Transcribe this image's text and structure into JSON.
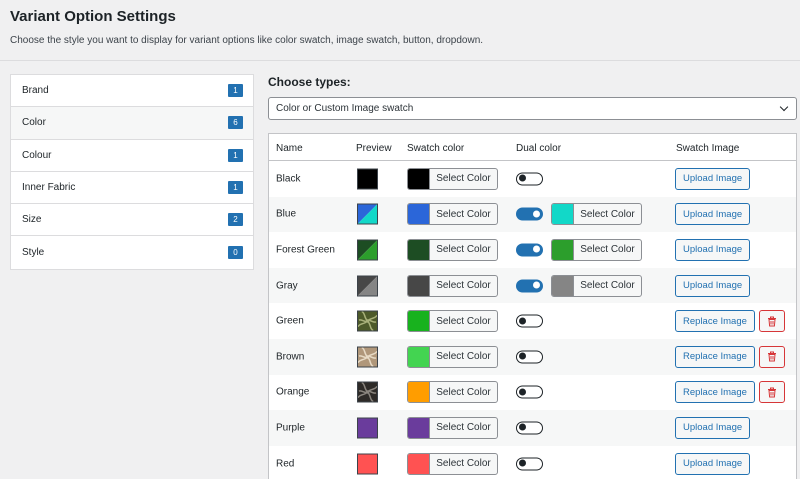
{
  "page": {
    "title": "Variant Option Settings",
    "description": "Choose the style you want to display for variant options like color swatch, image swatch, button, dropdown."
  },
  "attributes": [
    {
      "label": "Brand",
      "count": "1",
      "active": false
    },
    {
      "label": "Color",
      "count": "6",
      "active": true
    },
    {
      "label": "Colour",
      "count": "1",
      "active": false
    },
    {
      "label": "Inner Fabric",
      "count": "1",
      "active": false
    },
    {
      "label": "Size",
      "count": "2",
      "active": false
    },
    {
      "label": "Style",
      "count": "0",
      "active": false
    }
  ],
  "types": {
    "label": "Choose types:",
    "selected": "Color or Custom Image swatch"
  },
  "table": {
    "headers": {
      "name": "Name",
      "preview": "Preview",
      "swatch_color": "Swatch color",
      "dual_color": "Dual color",
      "swatch_image": "Swatch Image"
    },
    "select_color_label": "Select Color",
    "upload_label": "Upload Image",
    "replace_label": "Replace Image",
    "rows": [
      {
        "name": "Black",
        "preview": "solid",
        "color": "#000000",
        "dual": false,
        "dual_color": null,
        "has_image": false
      },
      {
        "name": "Blue",
        "preview": "split",
        "color": "#2b66d9",
        "dual": true,
        "dual_color": "#12d8c8",
        "has_image": false
      },
      {
        "name": "Forest Green",
        "preview": "split",
        "color": "#1d4d23",
        "dual": true,
        "dual_color": "#2c9e2c",
        "has_image": false
      },
      {
        "name": "Gray",
        "preview": "split",
        "color": "#474747",
        "dual": true,
        "dual_color": "#858585",
        "has_image": false
      },
      {
        "name": "Green",
        "preview": "image",
        "color": "#18b21e",
        "dual": false,
        "dual_color": null,
        "has_image": true,
        "image_colors": [
          "#4d5a2a",
          "#a8b07a"
        ]
      },
      {
        "name": "Brown",
        "preview": "image",
        "color": "#43d451",
        "dual": false,
        "dual_color": null,
        "has_image": true,
        "image_colors": [
          "#b0977a",
          "#e7dac5"
        ]
      },
      {
        "name": "Orange",
        "preview": "image",
        "color": "#ff9d00",
        "dual": false,
        "dual_color": null,
        "has_image": true,
        "image_colors": [
          "#2e2b28",
          "#8a857e"
        ]
      },
      {
        "name": "Purple",
        "preview": "solid",
        "color": "#6a3c9c",
        "dual": false,
        "dual_color": null,
        "has_image": false
      },
      {
        "name": "Red",
        "preview": "solid",
        "color": "#ff5252",
        "dual": false,
        "dual_color": null,
        "has_image": false
      }
    ]
  }
}
